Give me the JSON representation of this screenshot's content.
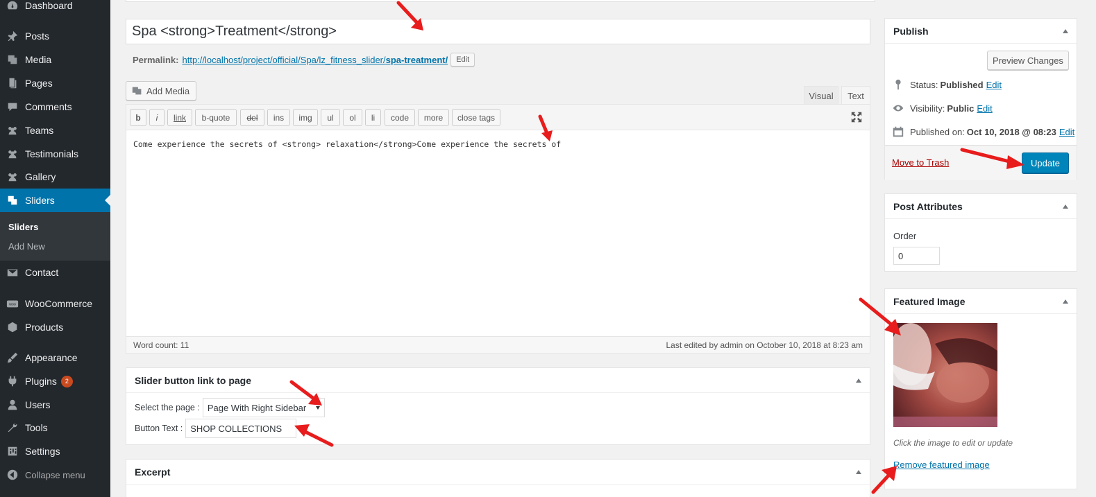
{
  "sidebar": {
    "items": [
      {
        "label": "Dashboard",
        "icon": "dashboard-icon"
      },
      {
        "label": "Posts",
        "icon": "pin-icon"
      },
      {
        "label": "Media",
        "icon": "media-icon"
      },
      {
        "label": "Pages",
        "icon": "pages-icon"
      },
      {
        "label": "Comments",
        "icon": "comments-icon"
      },
      {
        "label": "Teams",
        "icon": "groups-icon"
      },
      {
        "label": "Testimonials",
        "icon": "groups-icon"
      },
      {
        "label": "Gallery",
        "icon": "groups-icon"
      },
      {
        "label": "Sliders",
        "icon": "slides-icon"
      },
      {
        "label": "Contact",
        "icon": "email-icon"
      },
      {
        "label": "WooCommerce",
        "icon": "woo-icon"
      },
      {
        "label": "Products",
        "icon": "cube-icon"
      },
      {
        "label": "Appearance",
        "icon": "brush-icon"
      },
      {
        "label": "Plugins",
        "icon": "plugin-icon",
        "badge": "2"
      },
      {
        "label": "Users",
        "icon": "user-icon"
      },
      {
        "label": "Tools",
        "icon": "wrench-icon"
      },
      {
        "label": "Settings",
        "icon": "settings-icon"
      },
      {
        "label": "Collapse menu",
        "icon": "collapse-icon"
      }
    ],
    "submenu": {
      "current": "Sliders",
      "add_new": "Add New"
    }
  },
  "post": {
    "title": "Spa <strong>Treatment</strong>",
    "permalink_label": "Permalink:",
    "permalink_base": "http://localhost/project/official/Spa/lz_fitness_slider/",
    "permalink_slug": "spa-treatment/",
    "permalink_edit": "Edit"
  },
  "editor": {
    "add_media": "Add Media",
    "tab_visual": "Visual",
    "tab_text": "Text",
    "quicktags": [
      "b",
      "i",
      "link",
      "b-quote",
      "del",
      "ins",
      "img",
      "ul",
      "ol",
      "li",
      "code",
      "more",
      "close tags"
    ],
    "content": "Come experience the secrets of <strong> relaxation</strong>Come experience the secrets of",
    "word_count": "Word count: 11",
    "last_edited": "Last edited by admin on October 10, 2018 at 8:23 am"
  },
  "slider_box": {
    "title": "Slider button link to page",
    "select_label": "Select the page :",
    "select_value": "Page With Right Sidebar",
    "button_text_label": "Button Text :",
    "button_text_value": "SHOP COLLECTIONS"
  },
  "excerpt_box": {
    "title": "Excerpt"
  },
  "publish": {
    "title": "Publish",
    "preview": "Preview Changes",
    "status_label": "Status:",
    "status_value": "Published",
    "visibility_label": "Visibility:",
    "visibility_value": "Public",
    "published_label": "Published on:",
    "published_value": "Oct 10, 2018 @ 08:23",
    "edit": "Edit",
    "trash": "Move to Trash",
    "update": "Update"
  },
  "attributes": {
    "title": "Post Attributes",
    "order_label": "Order",
    "order_value": "0"
  },
  "featured": {
    "title": "Featured Image",
    "hint": "Click the image to edit or update",
    "remove": "Remove featured image"
  },
  "colors": {
    "sidebar": "#23282d",
    "active": "#0073aa",
    "primary_button": "#0085ba",
    "annotation_arrow": "#e81c1c"
  }
}
